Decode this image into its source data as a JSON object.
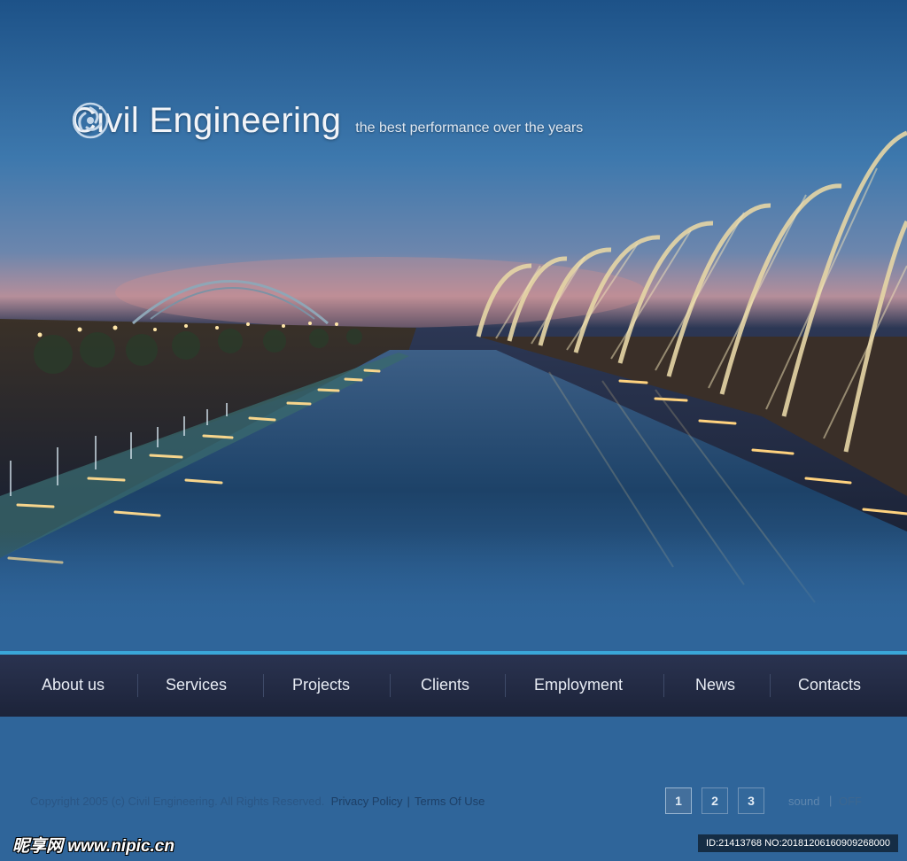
{
  "header": {
    "title": "Civil Engineering",
    "tagline": "the best performance over the years",
    "logo_icon": "swirl-logo-icon"
  },
  "nav": {
    "items": [
      {
        "label": "About us"
      },
      {
        "label": "Services"
      },
      {
        "label": "Projects"
      },
      {
        "label": "Clients"
      },
      {
        "label": "Employment"
      },
      {
        "label": "News"
      },
      {
        "label": "Contacts"
      }
    ]
  },
  "footer": {
    "copyright": "Copyright 2005 (c) Civil Engineering. All Rights Reserved.",
    "privacy": "Privacy Policy",
    "separator": "|",
    "terms": "Terms Of Use"
  },
  "pagination": {
    "pages": [
      "1",
      "2",
      "3"
    ],
    "active_page": "1"
  },
  "sound": {
    "label": "sound",
    "separator": "|",
    "state": "OFF"
  },
  "watermark": {
    "site": "昵享网 www.nipic.cn",
    "id": "ID:21413768 NO:20181206160909268000"
  },
  "colors": {
    "background": "#2f659a",
    "accent_line": "#3aa7d9",
    "nav_bg": "#222a44"
  }
}
